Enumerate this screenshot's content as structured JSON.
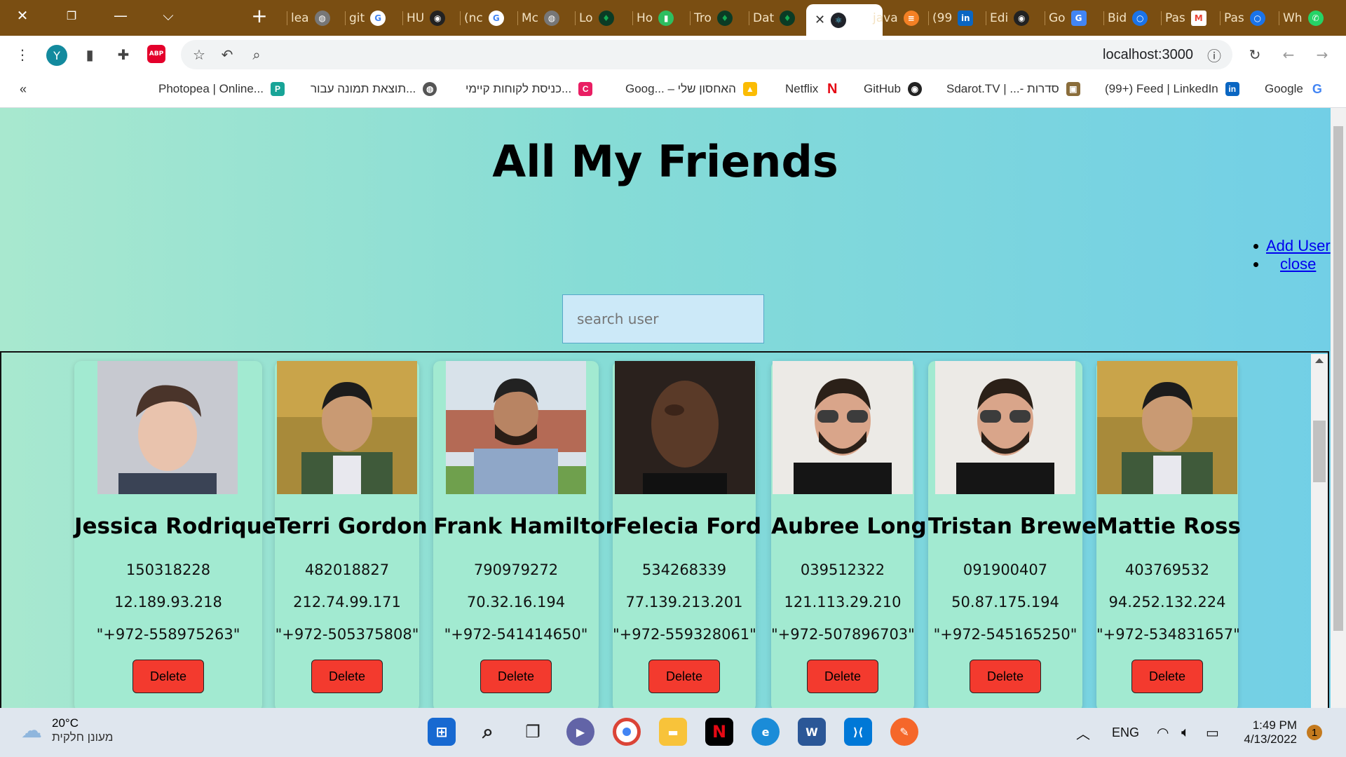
{
  "browser": {
    "tabs": [
      {
        "label": "lea",
        "icon": "globe-icon",
        "color": "#777"
      },
      {
        "label": "git",
        "icon": "google-icon",
        "color": "#4285f4"
      },
      {
        "label": "HU",
        "icon": "github-icon",
        "color": "#222"
      },
      {
        "label": "(nc",
        "icon": "google-icon",
        "color": "#4285f4"
      },
      {
        "label": "Mc",
        "icon": "globe-icon",
        "color": "#777"
      },
      {
        "label": "Lo",
        "icon": "mongodb-icon",
        "color": "#13aa52"
      },
      {
        "label": "Ho",
        "icon": "evernote-icon",
        "color": "#2dbe60"
      },
      {
        "label": "Tro",
        "icon": "mongodb-icon",
        "color": "#13aa52"
      },
      {
        "label": "Dat",
        "icon": "mongodb-icon",
        "color": "#13aa52"
      }
    ],
    "active_tab": {
      "icon": "react-icon"
    },
    "tabs_after": [
      {
        "label": "java",
        "icon": "stackoverflow-icon",
        "color": "#f48024"
      },
      {
        "label": "(99",
        "icon": "linkedin-icon",
        "color": "#0a66c2"
      },
      {
        "label": "Edi",
        "icon": "github-icon",
        "color": "#222"
      },
      {
        "label": "Go",
        "icon": "google-translate-icon",
        "color": "#4285f4"
      },
      {
        "label": "Bid",
        "icon": "circle-icon",
        "color": "#1a73e8"
      },
      {
        "label": "Pas",
        "icon": "gmail-icon",
        "color": "#ea4335"
      },
      {
        "label": "Pas",
        "icon": "circle-icon",
        "color": "#1a73e8"
      },
      {
        "label": "Wh",
        "icon": "whatsapp-icon",
        "color": "#25d366"
      }
    ],
    "profile_initial": "Y",
    "url": "localhost:3000",
    "bookmarks": [
      {
        "label": "Photopea | Online...",
        "color": "#18a497"
      },
      {
        "label": "תוצאת תמונה עבור...",
        "color": "#555"
      },
      {
        "label": "כניסת לקוחות קיימי...",
        "color": "#e91e63"
      },
      {
        "label": "Goog... – האחסון שלי",
        "color": "#1fa463"
      },
      {
        "label": "Netflix",
        "color": "#e50914"
      },
      {
        "label": "GitHub",
        "color": "#222"
      },
      {
        "label": "Sdarot.TV | ...- סדרות",
        "color": "#8a6d3b"
      },
      {
        "label": "(99+) Feed | LinkedIn",
        "color": "#0a66c2"
      },
      {
        "label": "Google",
        "color": "#4285f4"
      }
    ]
  },
  "app": {
    "title": "All My Friends",
    "nav": [
      "Add User",
      "close"
    ],
    "search_placeholder": "search user",
    "delete_label": "Delete",
    "friends": [
      {
        "name": "Jessica Rodriquez",
        "id": "150318228",
        "ip": "12.189.93.218",
        "phone": "\"+972-558975263\""
      },
      {
        "name": "Terri Gordon",
        "id": "482018827",
        "ip": "212.74.99.171",
        "phone": "\"+972-505375808\""
      },
      {
        "name": "Frank Hamilton",
        "id": "790979272",
        "ip": "70.32.16.194",
        "phone": "\"+972-541414650\""
      },
      {
        "name": "Felecia Ford",
        "id": "534268339",
        "ip": "77.139.213.201",
        "phone": "\"+972-559328061\""
      },
      {
        "name": "Aubree Long",
        "id": "039512322",
        "ip": "121.113.29.210",
        "phone": "\"+972-507896703\""
      },
      {
        "name": "Tristan Brewer",
        "id": "091900407",
        "ip": "50.87.175.194",
        "phone": "\"+972-545165250\""
      },
      {
        "name": "Mattie Ross",
        "id": "403769532",
        "ip": "94.252.132.224",
        "phone": "\"+972-534831657\""
      }
    ]
  },
  "taskbar": {
    "weather_temp": "20°C",
    "weather_desc": "מעונן חלקית",
    "lang": "ENG",
    "time": "1:49 PM",
    "date": "4/13/2022",
    "notifications": "1"
  }
}
